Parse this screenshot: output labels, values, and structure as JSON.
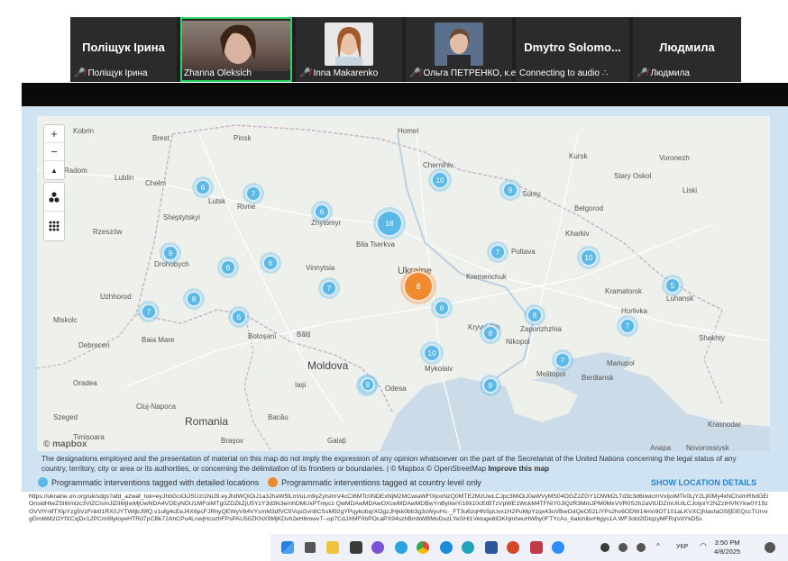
{
  "participants": [
    {
      "name": "Поліщук Ірина",
      "label": "Поліщук Ірина",
      "photo": false
    },
    {
      "name": "",
      "label": "Zhanna Oleksich",
      "photo": true,
      "active": true
    },
    {
      "name": "",
      "label": "Inna Makarenko",
      "photo": true
    },
    {
      "name": "",
      "label": "Ольга ПЕТРЕНКО, к.е...",
      "photo": true
    },
    {
      "name": "Dmytro  Solomo...",
      "label": "Connecting to audio",
      "photo": false
    },
    {
      "name": "Людмила",
      "label": "Людмила",
      "photo": false
    }
  ],
  "map": {
    "places": {
      "brest": "Brest",
      "pinsk": "Pinsk",
      "homel": "Homel",
      "kobrin": "Kobrin",
      "radom": "Radom",
      "lublin": "Lublin",
      "chelm": "Chełm",
      "lutsk": "Lutsk",
      "rivne": "Rivne",
      "sheptytskyi": "Sheptytskyi",
      "zhytomyr": "Zhytomyr",
      "chernihiv": "Chernihiv",
      "sumy": "Sumy",
      "kursk": "Kursk",
      "voronezh": "Voronezh",
      "stary_oskol": "Stary Oskol",
      "belgorod": "Belgorod",
      "liski": "Liski",
      "rzeszow": "Rzeszów",
      "bila_tserkva": "Bila Tserkva",
      "kharkiv": "Kharkiv",
      "poltava": "Poltava",
      "drohobych": "Drohobych",
      "vinnytsia": "Vinnytsia",
      "ukraine": "Ukraine",
      "kremenchuk": "Kremenchuk",
      "uzhhorod": "Uzhhorod",
      "kramatorsk": "Kramatorsk",
      "luhansk": "Luhansk",
      "kryvyi_rih": "Kryvyi Rih",
      "zaporizhzhia": "Zaporizhzhia",
      "horlivka": "Horlivka",
      "miskolc": "Miskolc",
      "baia_mare": "Baia Mare",
      "balti": "Bălți",
      "botosani": "Botoșani",
      "nikopol": "Nikopol",
      "debrecen": "Debrecen",
      "shakhty": "Shakhty",
      "moldova": "Moldova",
      "mykolaiv": "Mykolaiv",
      "mariupol": "Mariupol",
      "melitopol": "Melitopol",
      "oradea": "Oradea",
      "iasi": "Iași",
      "odesa": "Odesa",
      "berdiansk": "Berdiansk",
      "szeged": "Szeged",
      "cluj": "Cluj-Napoca",
      "bacau": "Bacău",
      "romania": "Romania",
      "timisoara": "Timișoara",
      "brasov": "Brașov",
      "galati": "Galați",
      "krasnodar": "Krasnodar",
      "anapa": "Anapa",
      "novorossiysk": "Novorossiysk"
    },
    "clusters": [
      {
        "value": "6"
      },
      {
        "value": "7"
      },
      {
        "value": "10"
      },
      {
        "value": "9"
      },
      {
        "value": "6"
      },
      {
        "value": "18"
      },
      {
        "value": "9"
      },
      {
        "value": "6"
      },
      {
        "value": "6"
      },
      {
        "value": "7"
      },
      {
        "value": "10"
      },
      {
        "value": "8"
      },
      {
        "value": "7"
      },
      {
        "value": "8"
      },
      {
        "value": "5"
      },
      {
        "value": "7"
      },
      {
        "value": "6"
      },
      {
        "value": "7"
      },
      {
        "value": "6"
      },
      {
        "value": "8"
      },
      {
        "value": "7"
      },
      {
        "value": "10"
      },
      {
        "value": "7"
      },
      {
        "value": "8"
      },
      {
        "value": "8"
      }
    ],
    "orange_cluster": "8",
    "zoom_in": "+",
    "zoom_out": "−",
    "compass": "▲",
    "attribution": "© mapbox"
  },
  "disclaimer": "The designations employed and the presentation of material on this map do not imply the expression of any opinion whatsoever on the part of the Secretariat of the United Nations concerning the legal status of any country, territory, city or area or its authorities, or concerning the delimitation of its frontiers or boundaries. | © Mapbox © OpenStreetMap",
  "improve_link": "Improve this map",
  "legend": {
    "detailed": "Programmatic interventions tagged with detailed locations",
    "country": "Programmatic interventions tagged at country level only",
    "show_details": "SHOW LOCATION DETAILS"
  },
  "url": "https://ukraine.un.org/uk/sdgs?afd_azwaf_tok=eyJhbGciOiJSUzI1NiJ9.eyJhdWQiOiJ1a3JhaW5lLnVuLm9yZyIsImV4cCI6MTc0NDExNjM2MCwiaWF0IjoxNzQ0MTE2MzUwLCJpc3MiOiJ0aWVyMS04OGZ2ZGY1OWM2LTd3c3d6IiwicmVxIjoiMTk0LjY2LjI0My4xNCIsImRhdGEiOnsidHlwZSI6Imlzc3VlZCIsInJlZiI6IjIwMjUwNDA4VDEyNDU1MFoiMTg0ZDZkZjU5YzY3d3N3emhDMUxPTnlycz QwMDAwMDAwOXcwMDAwMDBwYnByIiwiYi16Ii10cEtBTzVpWE1WckM4TFNiY0JlQzR3MmJPM0MxVVR0S2h2aVtUDZmUlUlLCJoIjoiY2NZzIHVNYkw0Y19zOVVlYnlfTXlpYzg5VzFnb01RX0JYTWljbJ9fQ.v1ufg4cEeJ4X6pcFJRhyQEWyV84VYsmM3dfVC5VqsGvn8CSsM92gYPqykobqrXOgzJHjkk0bb3g3sWyoHc-_FT3u6zqHNSpUxx1H2PuMpYzqx43oVBwGdQeO52LlYPs2hv6ODW14mn9OT101aLKVXCjhtasfaOSfjEIEQccTUrvvgGml6M2OYfXCxjDv12PCmi9lyloyeHTRd7pCBk72AhCPu4LnwjHcozhFPsPAU50ZKNX9MjKDvh2eH6mwvT--op7CdJXMF0bPOcaPX94szhBmbWBMoDuzLYeSHl1Vetuge6lOKhjinheuHWby0FTYcAs_6akmibvHtgys1A.WF3obl2lDtqzyMFRqVdYkD5s",
  "taskbar": {
    "keyboard": "УКР",
    "time": "3:50 PM",
    "date": "4/8/2025"
  }
}
